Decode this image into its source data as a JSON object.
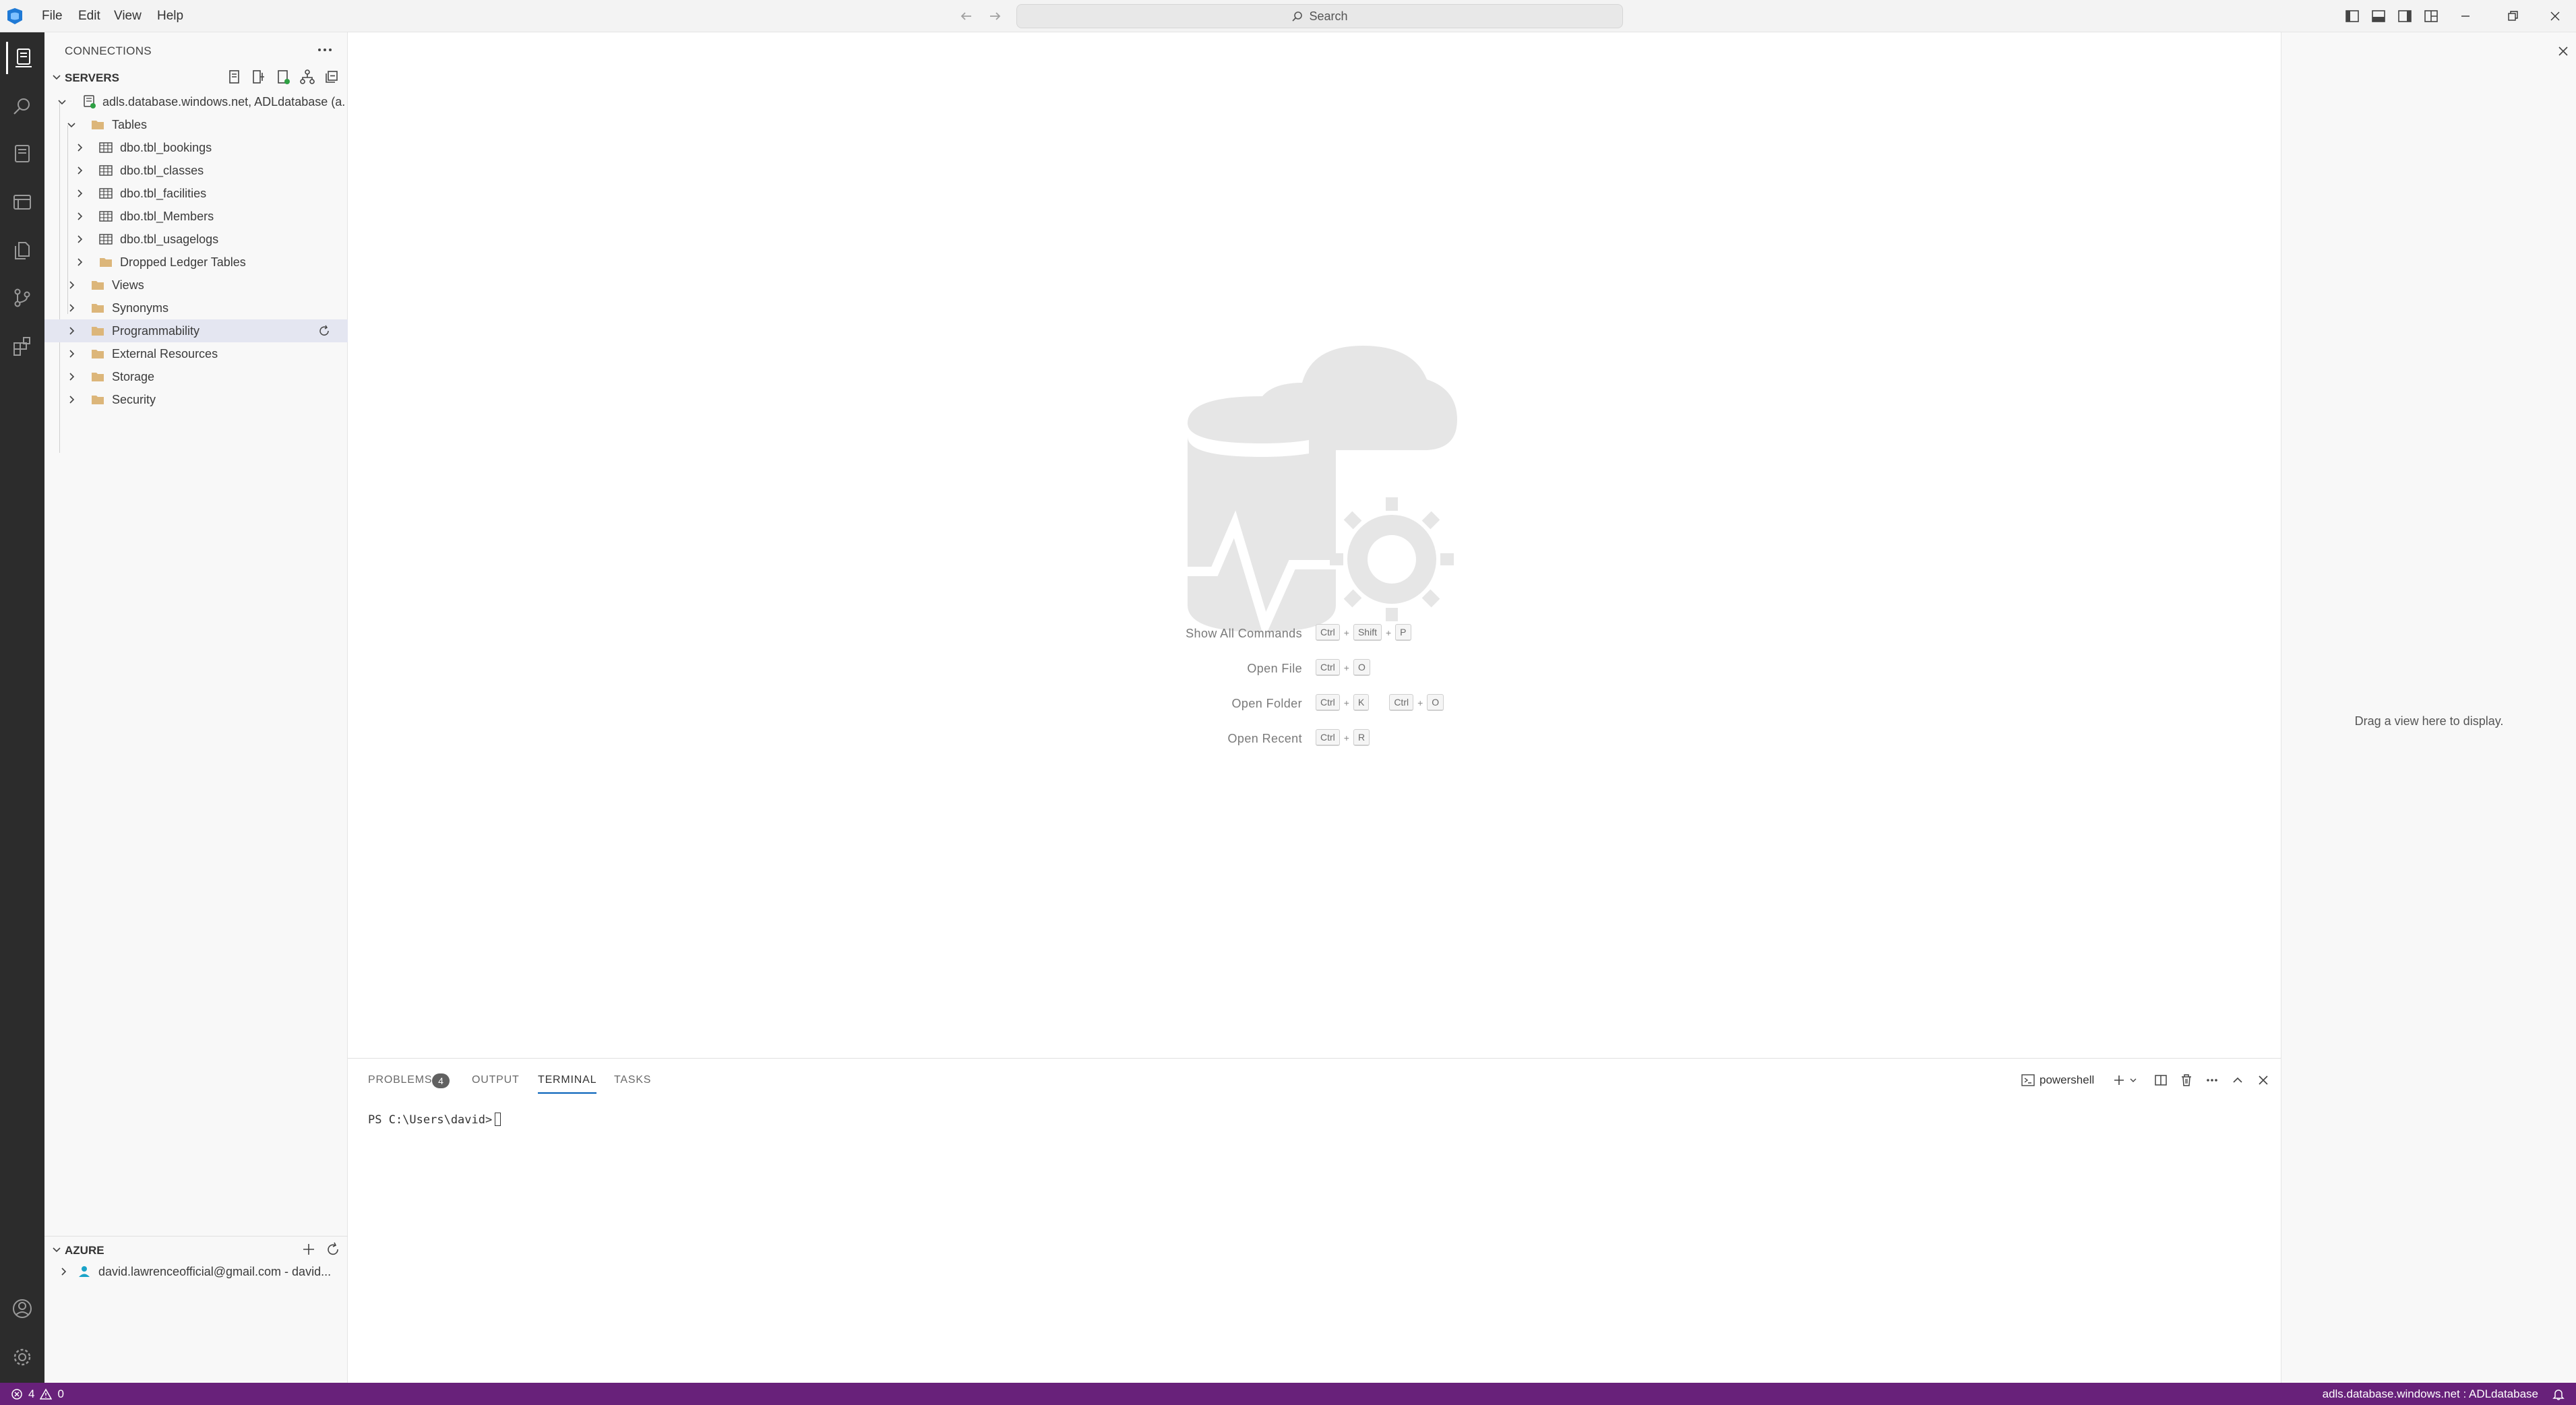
{
  "menu": {
    "file": "File",
    "edit": "Edit",
    "view": "View",
    "help": "Help"
  },
  "search": {
    "placeholder": "Search"
  },
  "sidebar": {
    "connections_title": "CONNECTIONS",
    "servers_title": "SERVERS",
    "server": {
      "label": "adls.database.windows.net, ADLdatabase (a...",
      "status": "connected"
    },
    "tree": {
      "tables": "Tables",
      "table_items": [
        "dbo.tbl_bookings",
        "dbo.tbl_classes",
        "dbo.tbl_facilities",
        "dbo.tbl_Members",
        "dbo.tbl_usagelogs"
      ],
      "dropped_ledger": "Dropped Ledger Tables",
      "folders": [
        "Views",
        "Synonyms",
        "Programmability",
        "External Resources",
        "Storage",
        "Security"
      ],
      "selected": "Programmability"
    },
    "azure_title": "AZURE",
    "azure_account": "david.lawrenceofficial@gmail.com - david..."
  },
  "welcome": {
    "shortcuts": [
      {
        "label": "Show All Commands",
        "keys": [
          [
            "Ctrl",
            "Shift",
            "P"
          ]
        ]
      },
      {
        "label": "Open File",
        "keys": [
          [
            "Ctrl",
            "O"
          ]
        ]
      },
      {
        "label": "Open Folder",
        "keys": [
          [
            "Ctrl",
            "K"
          ],
          [
            "Ctrl",
            "O"
          ]
        ]
      },
      {
        "label": "Open Recent",
        "keys": [
          [
            "Ctrl",
            "R"
          ]
        ]
      }
    ]
  },
  "aux": {
    "hint": "Drag a view here to display."
  },
  "panel": {
    "tabs": {
      "problems": "PROBLEMS",
      "output": "OUTPUT",
      "terminal": "TERMINAL",
      "tasks": "TASKS"
    },
    "problems_count": "4",
    "active_tab": "TERMINAL",
    "shell": "powershell",
    "prompt": "PS C:\\Users\\david>"
  },
  "status": {
    "errors": "4",
    "warnings": "0",
    "connection": "adls.database.windows.net : ADLdatabase"
  },
  "colors": {
    "accent": "#005fb8",
    "statusbar": "#68217a",
    "activitybar": "#2c2c2c",
    "folder": "#dcb67a"
  }
}
